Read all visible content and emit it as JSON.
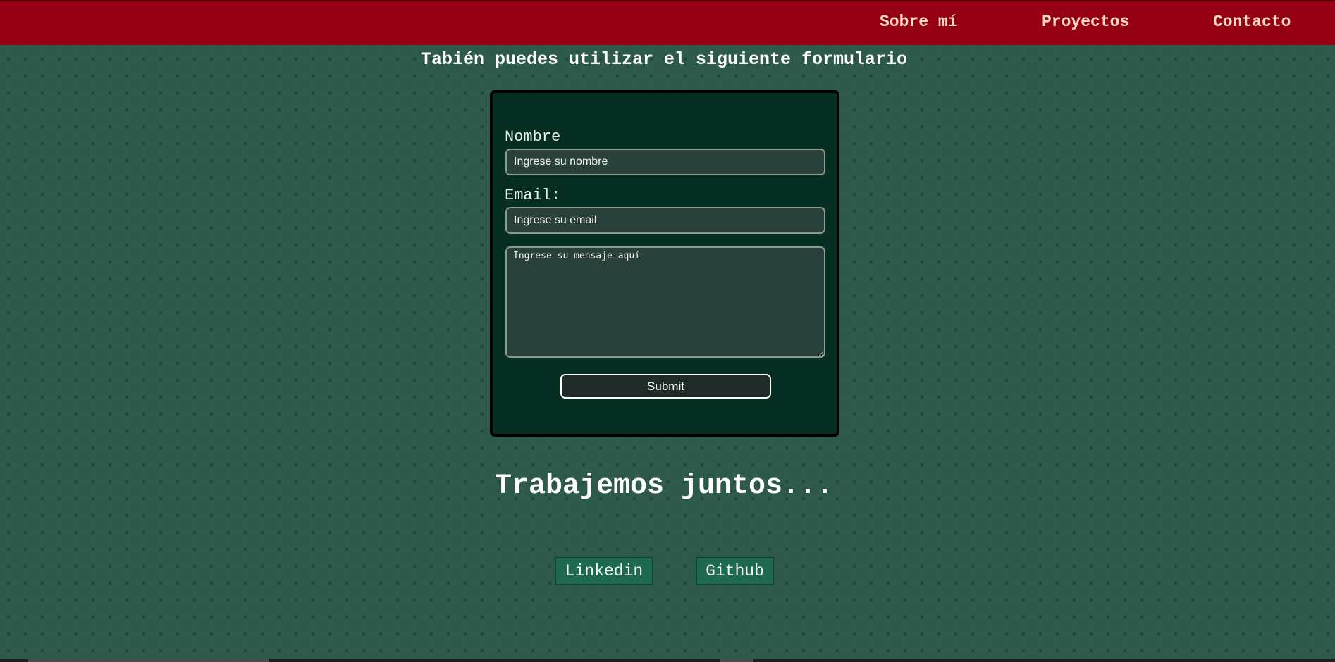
{
  "nav": {
    "items": [
      {
        "label": "Sobre mí"
      },
      {
        "label": "Proyectos"
      },
      {
        "label": "Contacto"
      }
    ]
  },
  "form_section": {
    "heading": "Tabién puedes utilizar el siguiente formulario",
    "name_label": "Nombre",
    "name_placeholder": "Ingrese su nombre",
    "email_label": "Email:",
    "email_placeholder": "Ingrese su email",
    "message_placeholder": "Ingrese su mensaje aquí",
    "submit_label": "Submit"
  },
  "social": {
    "heading": "Trabajemos juntos...",
    "links": [
      {
        "label": "Linkedin"
      },
      {
        "label": "Github"
      }
    ]
  },
  "colors": {
    "navbar": "#950014",
    "nav_text": "#ffd9c7",
    "page_background": "#2e5a4c",
    "form_background": "#062e22",
    "input_background": "#2a403b",
    "social_button": "#1e6a4f"
  }
}
